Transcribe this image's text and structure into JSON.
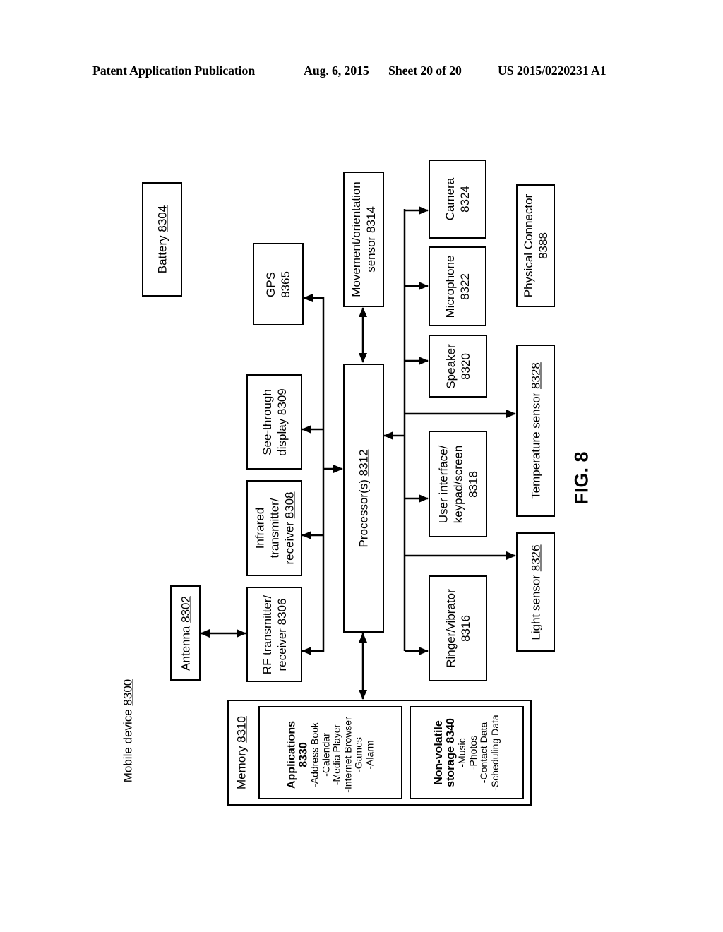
{
  "header": {
    "publication": "Patent Application Publication",
    "date": "Aug. 6, 2015",
    "sheet": "Sheet 20 of 20",
    "number": "US 2015/0220231 A1"
  },
  "figure_label": "FIG. 8",
  "device": {
    "label": "Mobile device",
    "ref": "8300"
  },
  "blocks": {
    "battery": {
      "lines": [
        "Battery"
      ],
      "ref": "8304",
      "ref_inline": true
    },
    "antenna": {
      "lines": [
        "Antenna"
      ],
      "ref": "8302",
      "ref_inline": true
    },
    "rf": {
      "lines": [
        "RF transmitter/",
        "receiver"
      ],
      "ref": "8306",
      "ref_inline": true
    },
    "infrared": {
      "lines": [
        "Infrared",
        "transmitter/",
        "receiver"
      ],
      "ref": "8308",
      "ref_inline": true
    },
    "see_through": {
      "lines": [
        "See-through",
        "display"
      ],
      "ref": "8309",
      "ref_inline": true
    },
    "gps": {
      "lines": [
        "GPS"
      ],
      "ref": "8365",
      "ref_inline": false
    },
    "movement": {
      "lines": [
        "Movement/orientation",
        "sensor"
      ],
      "ref": "8314",
      "ref_inline": true
    },
    "processor": {
      "lines": [
        "Processor(s)"
      ],
      "ref": "8312",
      "ref_inline": true
    },
    "camera": {
      "lines": [
        "Camera"
      ],
      "ref": "8324",
      "ref_inline": false
    },
    "microphone": {
      "lines": [
        "Microphone"
      ],
      "ref": "8322",
      "ref_inline": false
    },
    "speaker": {
      "lines": [
        "Speaker"
      ],
      "ref": "8320",
      "ref_inline": false
    },
    "user_interface": {
      "lines": [
        "User interface/",
        "keypad/screen"
      ],
      "ref": "8318",
      "ref_inline": false
    },
    "ringer": {
      "lines": [
        "Ringer/vibrator"
      ],
      "ref": "8316",
      "ref_inline": false
    },
    "physical_connector": {
      "lines": [
        "Physical Connector"
      ],
      "ref": "8388",
      "ref_inline": false
    },
    "temperature": {
      "lines": [
        "Temperature sensor"
      ],
      "ref": "8328",
      "ref_inline": true
    },
    "light": {
      "lines": [
        "Light sensor"
      ],
      "ref": "8326",
      "ref_inline": true
    }
  },
  "memory": {
    "label": "Memory",
    "ref": "8310",
    "applications": {
      "title": "Applications",
      "ref": "8330",
      "items": [
        "-Address Book",
        "-Calendar",
        "-Media Player",
        "-Internet Browser",
        "-Games",
        "-Alarm"
      ]
    },
    "storage": {
      "title_line1": "Non-volatile",
      "title_line2": "storage",
      "ref": "8340",
      "items": [
        "-Music",
        "-Photos",
        "-Contact Data",
        "-Scheduling Data"
      ]
    }
  }
}
